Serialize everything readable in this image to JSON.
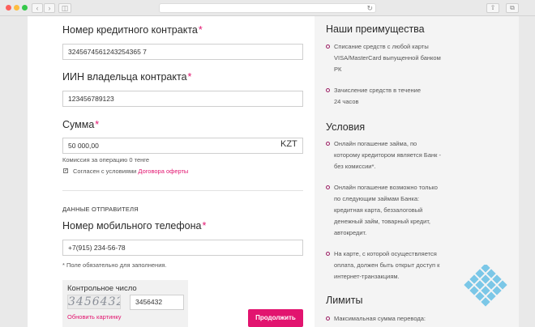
{
  "form": {
    "contract_label": "Номер кредитного контракта",
    "contract_value": "3245674561243254365 7",
    "iin_label": "ИИН владельца контракта",
    "iin_value": "123456789123",
    "amount_label": "Сумма",
    "amount_value": "50 000,00",
    "currency": "KZT",
    "commission_text": "Комиссия за операцию 0 тенге",
    "agree_text": "Согласен с условиями ",
    "agree_link": "Договора оферты",
    "required_mark": "*"
  },
  "sender": {
    "section_title": "ДАННЫЕ ОТПРАВИТЕЛЯ",
    "phone_label": "Номер мобильного телефона",
    "phone_value": "+7(915) 234-56-78",
    "required_note": "* Поле обязательно для заполнения."
  },
  "captcha": {
    "label": "Контрольное число",
    "image_text": "3456432",
    "input_value": "3456432",
    "refresh_link": "Обновить картинку"
  },
  "submit_label": "Продолжить",
  "sidebar": {
    "advantages_title": "Наши преимущества",
    "advantages": [
      [
        "Списание средств с любой карты",
        "VISA/MasterCard выпущенной банком",
        "РК"
      ],
      [
        "Зачисление средств в течение",
        "24 часов"
      ]
    ],
    "conditions_title": "Условия",
    "conditions": [
      [
        "Онлайн погашение займа, по",
        "которому кредитором является Банк -",
        "без комиссии*."
      ],
      [
        "Онлайн погашение возможно только",
        "по следующим займам Банка:",
        "кредитная карта, беззалоговый",
        "денежный займ, товарный кредит,",
        "автокредит."
      ],
      [
        "На карте, с которой осуществляется",
        "оплата, должен быть открыт доступ к",
        "интернет-транзакциям."
      ]
    ],
    "limits_title": "Лимиты",
    "limits": [
      [
        "Максимальная сумма перевода:"
      ]
    ]
  },
  "colors": {
    "accent": "#e2146f",
    "bullet": "#9b1d63",
    "logo": "#6ec3e6"
  }
}
